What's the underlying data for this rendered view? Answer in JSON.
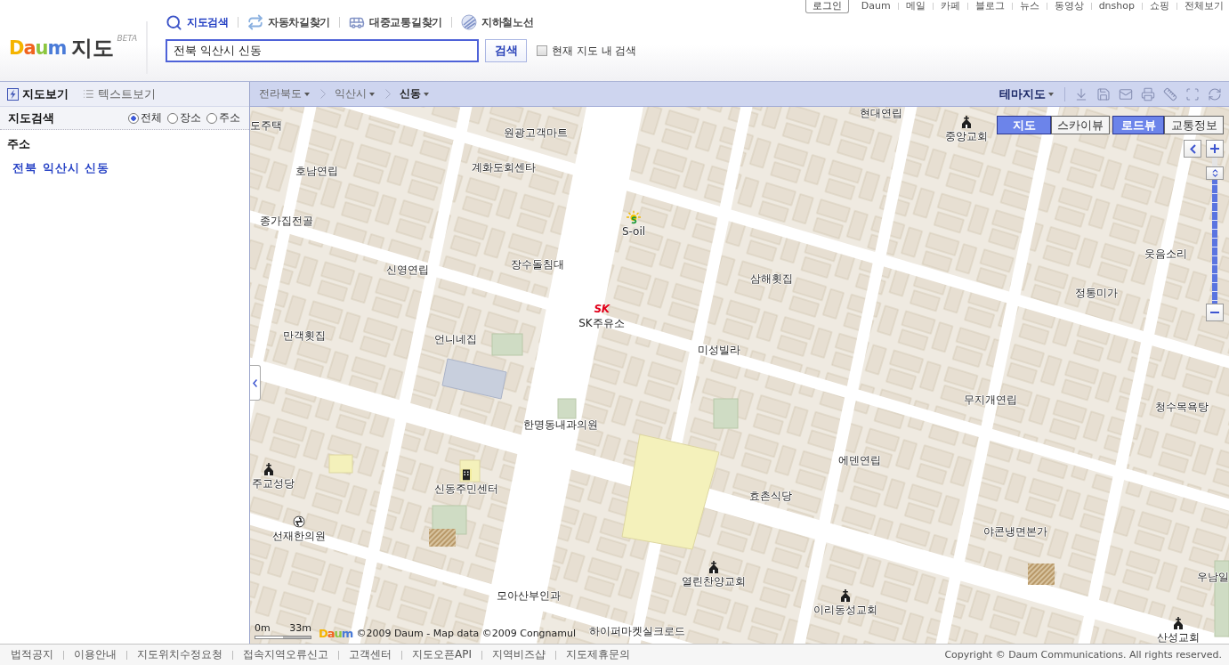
{
  "header": {
    "logo": {
      "brand": "Daum",
      "title": "지도",
      "badge": "BETA"
    },
    "nav_tabs": [
      {
        "label": "지도검색",
        "selected": true
      },
      {
        "label": "자동차길찾기",
        "selected": false
      },
      {
        "label": "대중교통길찾기",
        "selected": false
      },
      {
        "label": "지하철노선",
        "selected": false
      }
    ],
    "search": {
      "value": "전북 익산시 신동",
      "button": "검색",
      "option": {
        "label": "현재 지도 내 검색",
        "checked": false
      }
    },
    "login_button": "로그인",
    "top_links": [
      "Daum",
      "메일",
      "카페",
      "블로그",
      "뉴스",
      "동영상",
      "dnshop",
      "쇼핑",
      "전체보기"
    ]
  },
  "sidebar": {
    "tabs": [
      {
        "label": "지도보기",
        "selected": true
      },
      {
        "label": "텍스트보기",
        "selected": false
      }
    ],
    "search_title": "지도검색",
    "filters": [
      {
        "label": "전체",
        "selected": true
      },
      {
        "label": "장소",
        "selected": false
      },
      {
        "label": "주소",
        "selected": false
      }
    ],
    "section_title": "주소",
    "results": [
      "전북 익산시 신동"
    ]
  },
  "map": {
    "breadcrumb": [
      {
        "label": "전라북도",
        "selected": false
      },
      {
        "label": "익산시",
        "selected": false
      },
      {
        "label": "신동",
        "selected": true
      }
    ],
    "theme_menu": "테마지도",
    "view_modes": [
      {
        "label": "지도",
        "selected": true
      },
      {
        "label": "스카이뷰",
        "selected": false
      }
    ],
    "overlays": [
      {
        "label": "로드뷰",
        "on": true
      },
      {
        "label": "교통정보",
        "on": false
      }
    ],
    "zoom": {
      "level": 0.93
    },
    "places": [
      {
        "name": "도주택",
        "kind": "poi"
      },
      {
        "name": "원광고객마트",
        "kind": "poi"
      },
      {
        "name": "현대연립",
        "kind": "poi"
      },
      {
        "name": "중앙교회",
        "kind": "church"
      },
      {
        "name": "호남연립",
        "kind": "poi"
      },
      {
        "name": "계화도회센타",
        "kind": "poi"
      },
      {
        "name": "S-oil",
        "kind": "fuel"
      },
      {
        "name": "종가집전골",
        "kind": "poi"
      },
      {
        "name": "장수돌침대",
        "kind": "poi"
      },
      {
        "name": "삼해횟집",
        "kind": "poi"
      },
      {
        "name": "웃음소리",
        "kind": "poi"
      },
      {
        "name": "신영연립",
        "kind": "poi"
      },
      {
        "name": "정통미가",
        "kind": "poi"
      },
      {
        "name": "SK주유소",
        "kind": "logo",
        "logo": "SK"
      },
      {
        "name": "만객횟집",
        "kind": "poi"
      },
      {
        "name": "언니네집",
        "kind": "poi"
      },
      {
        "name": "미성빌라",
        "kind": "poi"
      },
      {
        "name": "한명동내과의원",
        "kind": "poi"
      },
      {
        "name": "무지개연립",
        "kind": "poi"
      },
      {
        "name": "청수목욕탕",
        "kind": "poi"
      },
      {
        "name": "주교성당",
        "kind": "church"
      },
      {
        "name": "에덴연립",
        "kind": "poi"
      },
      {
        "name": "신동주민센터",
        "kind": "office"
      },
      {
        "name": "효촌식당",
        "kind": "poi"
      },
      {
        "name": "선재한의원",
        "kind": "clinic"
      },
      {
        "name": "야콘냉면본가",
        "kind": "poi"
      },
      {
        "name": "열린찬양교회",
        "kind": "church"
      },
      {
        "name": "모아산부인과",
        "kind": "poi"
      },
      {
        "name": "우남일",
        "kind": "poi"
      },
      {
        "name": "이리동성교회",
        "kind": "church"
      },
      {
        "name": "하이퍼마켓실크로드",
        "kind": "poi"
      },
      {
        "name": "산성교회",
        "kind": "church"
      }
    ],
    "scale": {
      "start": "0m",
      "end": "33m"
    },
    "attribution": {
      "logo": "Daum",
      "text": "©2009 Daum - Map data ©2009 Congnamul"
    }
  },
  "footer": {
    "links": [
      "법적공지",
      "이용안내",
      "지도위치수정요청",
      "접속지역오류신고",
      "고객센터",
      "지도오픈API",
      "지역비즈샵",
      "지도제휴문의"
    ],
    "copyright": "Copyright © Daum Communications. All rights reserved."
  }
}
